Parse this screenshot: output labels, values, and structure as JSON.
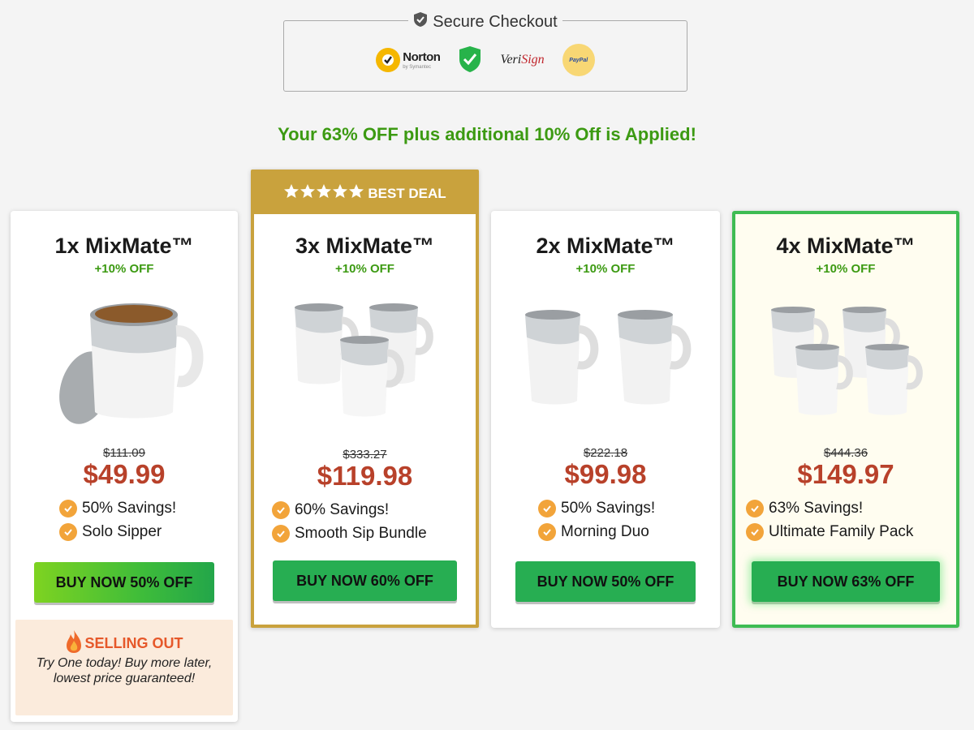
{
  "secure": {
    "title": "Secure Checkout",
    "norton": "Norton",
    "norton_sub": "by Symantec",
    "verisign_a": "Veri",
    "verisign_b": "Sign",
    "paypal": "PayPal"
  },
  "banner": "Your 63% OFF plus additional 10% Off is Applied!",
  "best_deal": "BEST DEAL",
  "cards": [
    {
      "title": "1x MixMate™",
      "sub": "+10% OFF",
      "old_price": "$111.09",
      "price": "$49.99",
      "b1": "50% Savings!",
      "b2": "Solo Sipper",
      "buy": "BUY NOW 50% OFF"
    },
    {
      "title": "3x MixMate™",
      "sub": "+10% OFF",
      "old_price": "$333.27",
      "price": "$119.98",
      "b1": "60% Savings!",
      "b2": "Smooth Sip Bundle",
      "buy": "BUY NOW 60% OFF"
    },
    {
      "title": "2x MixMate™",
      "sub": "+10% OFF",
      "old_price": "$222.18",
      "price": "$99.98",
      "b1": "50% Savings!",
      "b2": "Morning Duo",
      "buy": "BUY NOW 50% OFF"
    },
    {
      "title": "4x MixMate™",
      "sub": "+10% OFF",
      "old_price": "$444.36",
      "price": "$149.97",
      "b1": "63% Savings!",
      "b2": "Ultimate Family Pack",
      "buy": "BUY NOW 63% OFF"
    }
  ],
  "selling_out": {
    "title": "SELLING OUT",
    "text": "Try One today! Buy more later, lowest price guaranteed!"
  }
}
